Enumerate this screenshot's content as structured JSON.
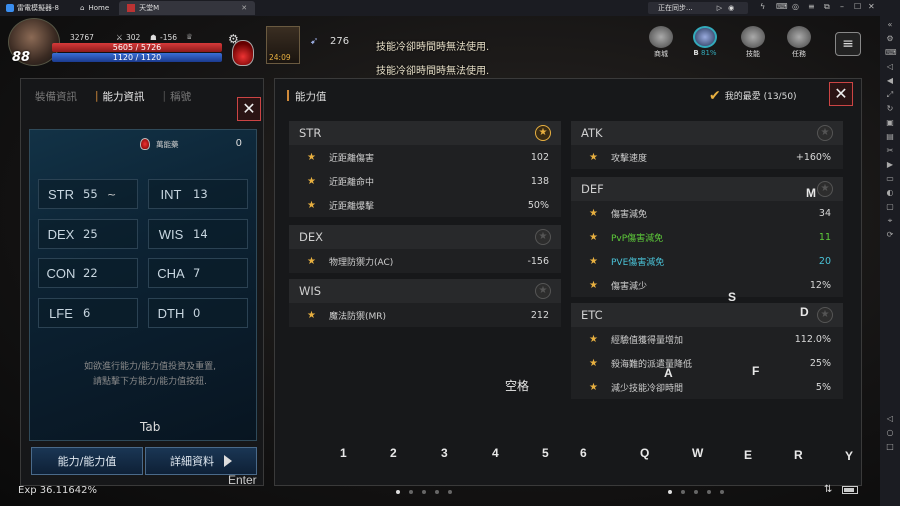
{
  "emulator": {
    "app_name": "雷電模擬器-8",
    "home_tab": "Home",
    "game_tab": "天堂M",
    "sync_status": "正在同步..."
  },
  "hud": {
    "level": "88",
    "power": "32767",
    "stat_a": "302",
    "stat_b": "-156",
    "hp": "5605 / 5726",
    "mp": "1120 / 1120",
    "slot_count": "276",
    "slot_timer": "24:09",
    "notice_1": "技能冷卻時間時無法使用.",
    "notice_2": "技能冷卻時間時無法使用.",
    "icons": [
      "商城",
      "B",
      "技能",
      "任務"
    ],
    "b_percent": "81%"
  },
  "left_panel": {
    "tabs": [
      "裝備資訊",
      "能力資訊",
      "稱號"
    ],
    "active_tab": 1,
    "points_label": "萬能藥",
    "points_value": "0",
    "stats": [
      {
        "key": "STR",
        "value": "55"
      },
      {
        "key": "INT",
        "value": "13"
      },
      {
        "key": "DEX",
        "value": "25"
      },
      {
        "key": "WIS",
        "value": "14"
      },
      {
        "key": "CON",
        "value": "22"
      },
      {
        "key": "CHA",
        "value": "7"
      },
      {
        "key": "LFE",
        "value": "6"
      },
      {
        "key": "DTH",
        "value": "0"
      }
    ],
    "hint_line1": "如欲進行能力/能力值投資及重置,",
    "hint_line2": "請點擊下方能力/能力值按鈕.",
    "tab_key": "Tab",
    "btn_ability": "能力/能力值",
    "btn_detail": "詳細資料"
  },
  "right_panel": {
    "title": "能力值",
    "favorites": "我的最愛 (13/50)",
    "sections_left": [
      {
        "name": "STR",
        "starred": true,
        "rows": [
          {
            "label": "近距離傷害",
            "value": "102"
          },
          {
            "label": "近距離命中",
            "value": "138"
          },
          {
            "label": "近距離爆擊",
            "value": "50%"
          }
        ]
      },
      {
        "name": "DEX",
        "starred": false,
        "rows": [
          {
            "label": "物理防禦力(AC)",
            "value": "-156"
          }
        ]
      },
      {
        "name": "WIS",
        "starred": false,
        "rows": [
          {
            "label": "魔法防禦(MR)",
            "value": "212"
          }
        ]
      }
    ],
    "sections_right": [
      {
        "name": "ATK",
        "starred": false,
        "rows": [
          {
            "label": "攻擊速度",
            "value": "+160%"
          }
        ]
      },
      {
        "name": "DEF",
        "starred": false,
        "rows": [
          {
            "label": "傷害減免",
            "value": "34",
            "style": ""
          },
          {
            "label": "PvP傷害減免",
            "value": "11",
            "style": "green"
          },
          {
            "label": "PVE傷害減免",
            "value": "20",
            "style": "cyan"
          },
          {
            "label": "傷害減少",
            "value": "12%",
            "style": ""
          }
        ]
      },
      {
        "name": "ETC",
        "starred": false,
        "rows": [
          {
            "label": "經驗值獲得量增加",
            "value": "112.0%"
          },
          {
            "label": "殺海難的派遣量降低",
            "value": "25%"
          },
          {
            "label": "減少技能冷卻時間",
            "value": "5%"
          }
        ]
      }
    ]
  },
  "keymap": {
    "space": "空格",
    "enter": "Enter",
    "m": "M",
    "s": "S",
    "a": "A",
    "d": "D",
    "f": "F",
    "nums": [
      "1",
      "2",
      "3",
      "4",
      "5",
      "6"
    ],
    "letters": [
      "Q",
      "W",
      "E",
      "R",
      "Y"
    ]
  },
  "footer": {
    "exp": "Exp 36.11642%"
  }
}
